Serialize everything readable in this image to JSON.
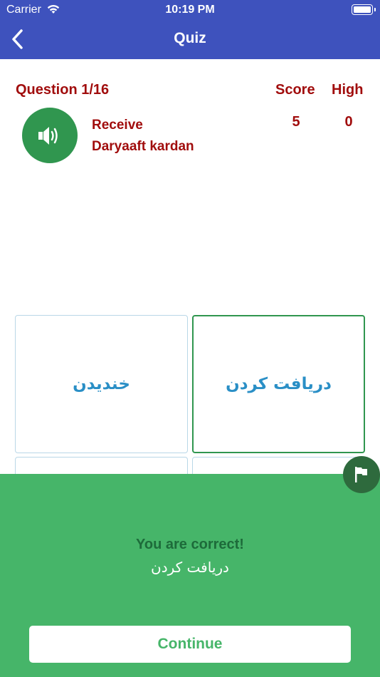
{
  "status_bar": {
    "carrier": "Carrier",
    "time": "10:19 PM"
  },
  "nav": {
    "title": "Quiz"
  },
  "quiz": {
    "question_label": "Question 1/16",
    "score_label": "Score",
    "high_label": "High",
    "score_value": "5",
    "high_value": "0",
    "word": "Receive",
    "transliteration": "Daryaaft kardan"
  },
  "options": [
    {
      "text": "خندیدن"
    },
    {
      "text": "دریافت کردن"
    },
    {
      "text": ""
    },
    {
      "text": ""
    }
  ],
  "result": {
    "title": "You are correct!",
    "answer": "دریافت کردن",
    "continue_label": "Continue"
  },
  "colors": {
    "header": "#3e52bd",
    "accent_red": "#a10d0d",
    "speaker_green": "#30964f",
    "panel_green": "#46b569",
    "option_text": "#2a8fc6"
  },
  "icons": {
    "back": "chevron-left-icon",
    "speaker": "speaker-icon",
    "flag": "flag-icon",
    "wifi": "wifi-icon",
    "battery": "battery-icon"
  }
}
